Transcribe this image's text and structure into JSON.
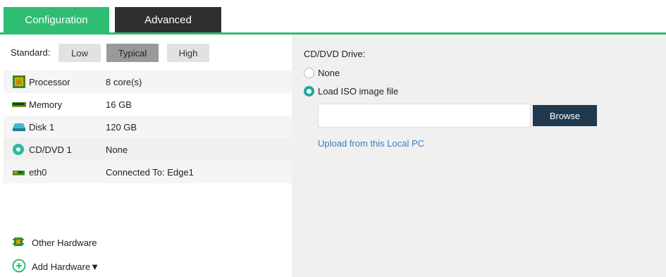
{
  "tabs": [
    {
      "label": "Configuration",
      "active": true,
      "color": "#2ebd73"
    },
    {
      "label": "Advanced",
      "active": false,
      "color": "#2f2f2f"
    }
  ],
  "standard": {
    "label": "Standard:",
    "options": [
      "Low",
      "Typical",
      "High"
    ],
    "selected": "Typical"
  },
  "hardware": [
    {
      "name": "Processor",
      "value": "8 core(s)",
      "icon": "processor-icon"
    },
    {
      "name": "Memory",
      "value": "16 GB",
      "icon": "memory-icon"
    },
    {
      "name": "Disk 1",
      "value": "120 GB",
      "icon": "disk-icon"
    },
    {
      "name": "CD/DVD 1",
      "value": "None",
      "icon": "cd-dvd-icon"
    },
    {
      "name": "eth0",
      "value": "Connected To: Edge1",
      "icon": "network-card-icon"
    }
  ],
  "other_hardware": {
    "label": "Other Hardware",
    "icon": "other-hardware-icon"
  },
  "add_hardware": {
    "label": "Add Hardware▼",
    "icon": "add-circle-icon"
  },
  "cd_panel": {
    "title": "CD/DVD Drive:",
    "options": [
      "None",
      "Load ISO image file"
    ],
    "selected": "Load ISO image file",
    "iso_value": "",
    "browse_label": "Browse",
    "upload_link": "Upload from this Local PC"
  },
  "colors": {
    "accent": "#2ebd73",
    "browse": "#1f3a4f",
    "link": "#3a7cc0",
    "radio_checked": "#1aa9a0"
  }
}
